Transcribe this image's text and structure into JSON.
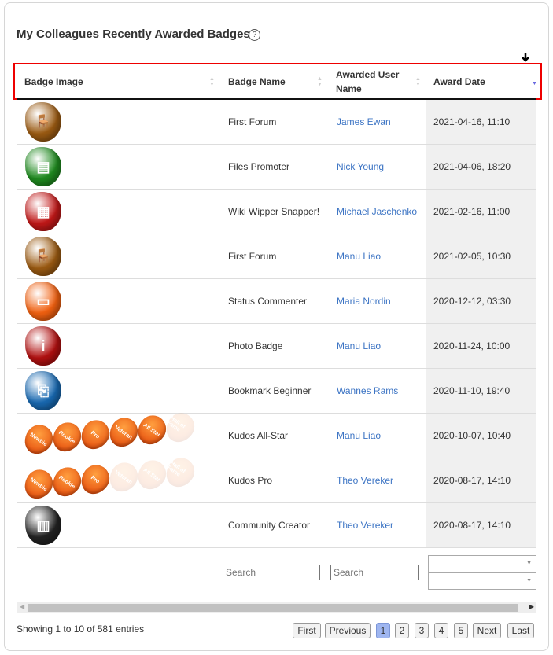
{
  "title": "My Colleagues Recently Awarded Badges",
  "help_icon": "?",
  "columns": [
    "Badge Image",
    "Badge Name",
    "Awarded User Name",
    "Award Date"
  ],
  "rows": [
    {
      "badge": "First Forum",
      "user": "James Ewan",
      "date": "2021-04-16, 11:10",
      "icon": "desk-icon",
      "color": "#9a5a12"
    },
    {
      "badge": "Files Promoter",
      "user": "Nick Young",
      "date": "2021-04-06, 18:20",
      "icon": "files-icon",
      "color": "#1f8a1f"
    },
    {
      "badge": "Wiki Wipper Snapper!",
      "user": "Michael Jaschenko",
      "date": "2021-02-16, 11:00",
      "icon": "wiki-page-icon",
      "color": "#c01818"
    },
    {
      "badge": "First Forum",
      "user": "Manu Liao",
      "date": "2021-02-05, 10:30",
      "icon": "desk-icon",
      "color": "#9a5a12"
    },
    {
      "badge": "Status Commenter",
      "user": "Maria Nordin",
      "date": "2020-12-12, 03:30",
      "icon": "comment-icon",
      "color": "#f06010"
    },
    {
      "badge": "Photo Badge",
      "user": "Manu Liao",
      "date": "2020-11-24, 10:00",
      "icon": "person-info-icon",
      "color": "#b01010"
    },
    {
      "badge": "Bookmark Beginner",
      "user": "Wannes Rams",
      "date": "2020-11-10, 19:40",
      "icon": "bookmark-icon",
      "color": "#1868b0"
    },
    {
      "badge": "Kudos All-Star",
      "user": "Manu Liao",
      "date": "2020-10-07, 10:40",
      "kudos_level": 5
    },
    {
      "badge": "Kudos Pro",
      "user": "Theo Vereker",
      "date": "2020-08-17, 14:10",
      "kudos_level": 3
    },
    {
      "badge": "Community Creator",
      "user": "Theo Vereker",
      "date": "2020-08-17, 14:10",
      "icon": "buildings-icon",
      "color": "#222222"
    }
  ],
  "kudos_labels": [
    "Newbie",
    "Rookie",
    "Pro",
    "Veteran",
    "All Star",
    "Hall of Fame"
  ],
  "search_placeholder": "Search",
  "info": "Showing 1 to 10 of 581 entries",
  "pagination": [
    "First",
    "Previous",
    "1",
    "2",
    "3",
    "4",
    "5",
    "Next",
    "Last"
  ],
  "current_page": "1"
}
